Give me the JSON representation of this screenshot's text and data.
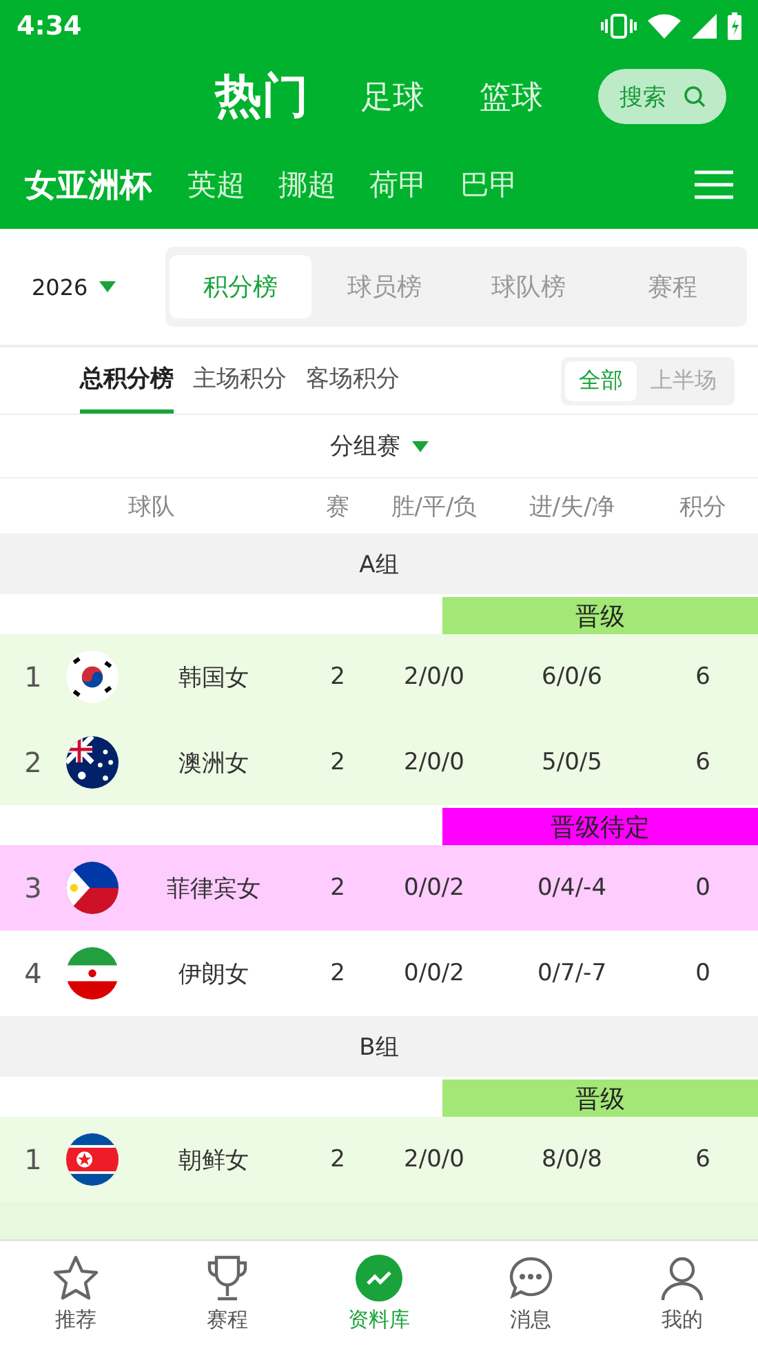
{
  "status_bar": {
    "time": "4:34"
  },
  "header": {
    "tabs": [
      {
        "label": "热门",
        "selected": true
      },
      {
        "label": "足球",
        "selected": false
      },
      {
        "label": "篮球",
        "selected": false
      }
    ],
    "search": {
      "label": "搜索"
    }
  },
  "leagues": [
    {
      "label": "女亚洲杯",
      "selected": true
    },
    {
      "label": "英超",
      "selected": false
    },
    {
      "label": "挪超",
      "selected": false
    },
    {
      "label": "荷甲",
      "selected": false
    },
    {
      "label": "巴甲",
      "selected": false
    }
  ],
  "season": {
    "value": "2026"
  },
  "data_tabs": [
    {
      "label": "积分榜",
      "selected": true
    },
    {
      "label": "球员榜",
      "selected": false
    },
    {
      "label": "球队榜",
      "selected": false
    },
    {
      "label": "赛程",
      "selected": false
    }
  ],
  "standing_tabs": [
    {
      "label": "总积分榜",
      "selected": true
    },
    {
      "label": "主场积分",
      "selected": false
    },
    {
      "label": "客场积分",
      "selected": false
    }
  ],
  "period_toggle": [
    {
      "label": "全部",
      "selected": true
    },
    {
      "label": "上半场",
      "selected": false
    }
  ],
  "stage": {
    "value": "分组赛"
  },
  "columns": [
    "球队",
    "赛",
    "胜/平/负",
    "进/失/净",
    "积分"
  ],
  "groups": [
    {
      "name": "A组",
      "sections": [
        {
          "banner": "晋级",
          "color": "#a3e876",
          "rows": [
            {
              "rank": "1",
              "kind": "korea",
              "team": "韩国女",
              "played": "2",
              "wdl": "2/0/0",
              "goals": "6/0/6",
              "points": "6"
            },
            {
              "rank": "2",
              "kind": "australia",
              "team": "澳洲女",
              "played": "2",
              "wdl": "2/0/0",
              "goals": "5/0/5",
              "points": "6"
            }
          ]
        },
        {
          "banner": "晋级待定",
          "color": "#ff00ff",
          "rows": [
            {
              "rank": "3",
              "kind": "philippines",
              "team": "菲律宾女",
              "played": "2",
              "wdl": "0/0/2",
              "goals": "0/4/-4",
              "points": "0"
            }
          ]
        },
        {
          "rows": [
            {
              "rank": "4",
              "kind": "iran",
              "team": "伊朗女",
              "played": "2",
              "wdl": "0/0/2",
              "goals": "0/7/-7",
              "points": "0"
            }
          ]
        }
      ]
    },
    {
      "name": "B组",
      "sections": [
        {
          "banner": "晋级",
          "color": "#a3e876",
          "rows": [
            {
              "rank": "1",
              "kind": "dprk",
              "team": "朝鲜女",
              "played": "2",
              "wdl": "2/0/0",
              "goals": "8/0/8",
              "points": "6"
            }
          ]
        }
      ]
    }
  ],
  "bottom_nav": [
    {
      "kind": "star",
      "label": "推荐",
      "selected": false
    },
    {
      "kind": "trophy",
      "label": "赛程",
      "selected": false
    },
    {
      "kind": "chart",
      "label": "资料库",
      "selected": true
    },
    {
      "kind": "chat",
      "label": "消息",
      "selected": false
    },
    {
      "kind": "person",
      "label": "我的",
      "selected": false
    }
  ]
}
